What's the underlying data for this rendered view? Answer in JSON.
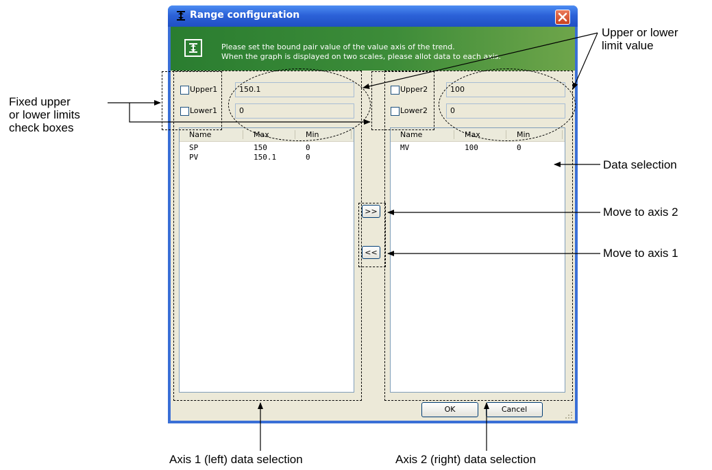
{
  "window": {
    "title": "Range configuration"
  },
  "banner": {
    "line1": "Please set the bound pair value of the value axis of the trend.",
    "line2": "When the graph is displayed on two scales, please allot data to each axis."
  },
  "axis1": {
    "upper_label": "Upper1",
    "lower_label": "Lower1",
    "upper_value": "150.1",
    "lower_value": "0",
    "columns": [
      "Name",
      "Max",
      "Min"
    ],
    "rows": [
      {
        "name": "SP",
        "max": "150",
        "min": "0"
      },
      {
        "name": "PV",
        "max": "150.1",
        "min": "0"
      }
    ]
  },
  "axis2": {
    "upper_label": "Upper2",
    "lower_label": "Lower2",
    "upper_value": "100",
    "lower_value": "0",
    "columns": [
      "Name",
      "Max",
      "Min"
    ],
    "rows": [
      {
        "name": "MV",
        "max": "100",
        "min": "0"
      }
    ]
  },
  "buttons": {
    "move_to_axis2": ">>",
    "move_to_axis1": "<<",
    "ok": "OK",
    "cancel": "Cancel"
  },
  "annotations": {
    "fixed_checkboxes": [
      "Fixed upper",
      "or lower limits",
      "check boxes"
    ],
    "limit_value": [
      "Upper or lower",
      "limit value"
    ],
    "data_selection": "Data selection",
    "move_axis2": "Move to axis 2",
    "move_axis1": "Move to axis 1",
    "axis1_selection": "Axis 1 (left) data selection",
    "axis2_selection": "Axis 2 (right) data selection"
  },
  "colors": {
    "titlebar": "#2c62d8",
    "banner": "#3d8c39",
    "client": "#ece9d8"
  }
}
